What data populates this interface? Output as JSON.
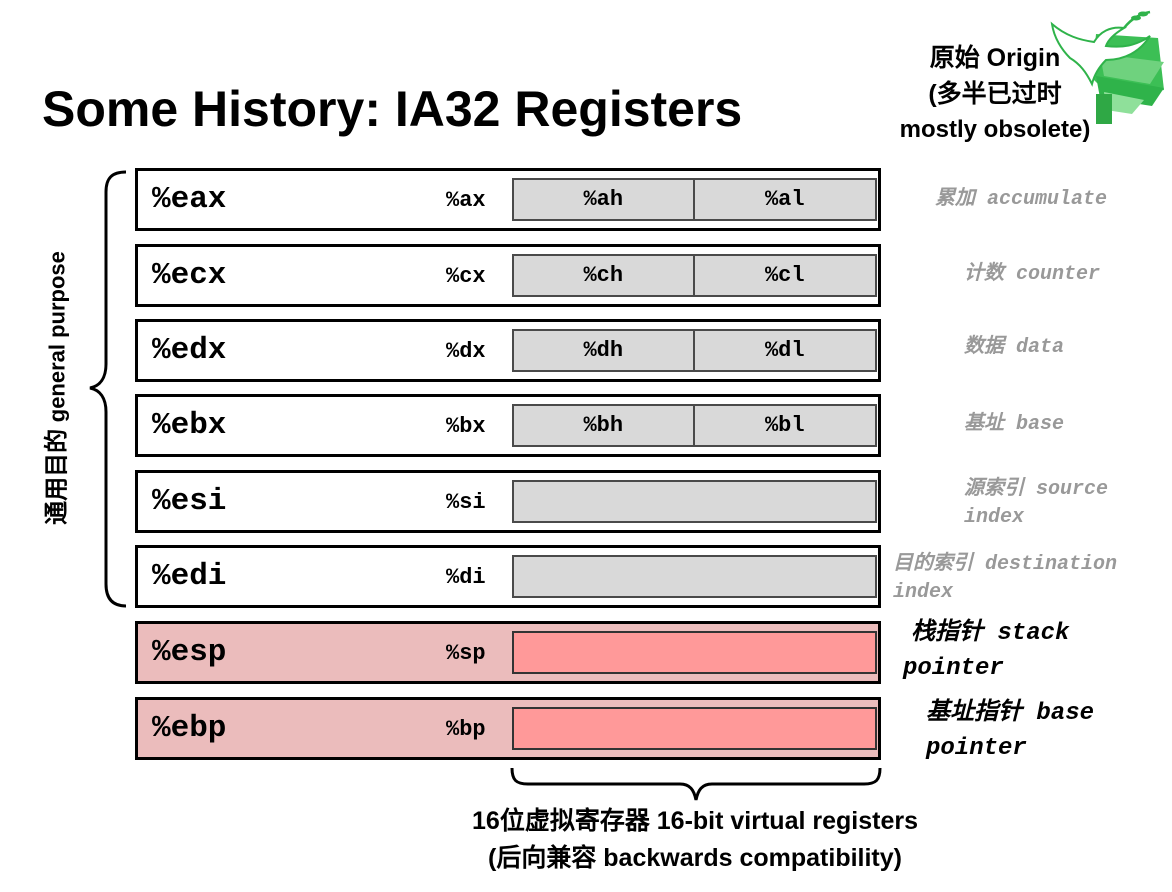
{
  "title": "Some History: IA32 Registers",
  "origin_note": {
    "line1": "原始 Origin",
    "line2": "(多半已过时",
    "line3": "mostly obsolete)"
  },
  "general_purpose_label": {
    "zh": "通用目的",
    "en": "general purpose"
  },
  "registers": [
    {
      "name": "%eax",
      "sub": "%ax",
      "high": "%ah",
      "low": "%al",
      "role_zh": "累加",
      "role_en": "accumulate"
    },
    {
      "name": "%ecx",
      "sub": "%cx",
      "high": "%ch",
      "low": "%cl",
      "role_zh": "计数",
      "role_en": "counter"
    },
    {
      "name": "%edx",
      "sub": "%dx",
      "high": "%dh",
      "low": "%dl",
      "role_zh": "数据",
      "role_en": "data"
    },
    {
      "name": "%ebx",
      "sub": "%bx",
      "high": "%bh",
      "low": "%bl",
      "role_zh": "基址",
      "role_en": "base"
    },
    {
      "name": "%esi",
      "sub": "%si",
      "role_zh": "源索引",
      "role_en": "source",
      "role_en2": "index"
    },
    {
      "name": "%edi",
      "sub": "%di",
      "role_zh": "目的索引",
      "role_en": "destination",
      "role_en2": "index"
    },
    {
      "name": "%esp",
      "sub": "%sp",
      "role_zh": "栈指针",
      "role_en": "stack",
      "role_en2": "pointer"
    },
    {
      "name": "%ebp",
      "sub": "%bp",
      "role_zh": "基址指针",
      "role_en": "base",
      "role_en2": "pointer"
    }
  ],
  "bottom_note": {
    "line1": "16位虚拟寄存器 16-bit virtual registers",
    "line2": "(后向兼容 backwards compatibility)"
  },
  "colors": {
    "register_fill": "#ffffff",
    "pointer_register_fill": "#ebbcbc",
    "sub_register_fill": "#d9d9d9",
    "pointer_sub_register_fill": "#ff9999",
    "role_label_gray": "#999999",
    "logo_green": "#2fb34a"
  },
  "logo": {
    "icon": "dove-tree-logo-icon"
  }
}
